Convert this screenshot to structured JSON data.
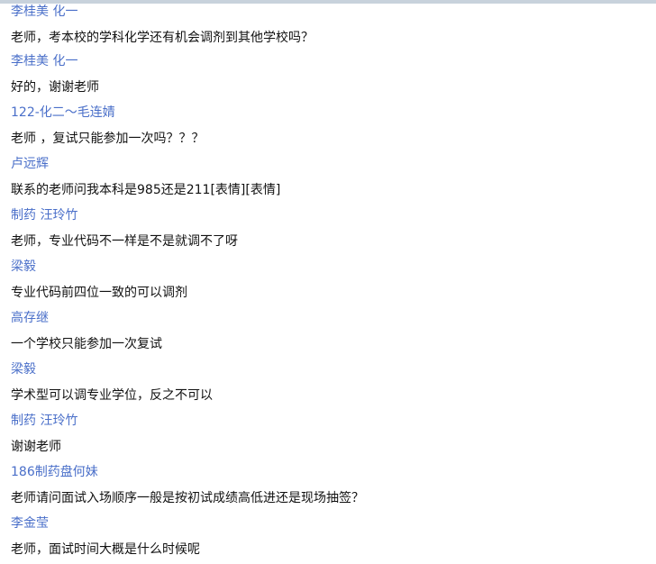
{
  "colors": {
    "sender": "#4a6fc9",
    "text": "#111111",
    "top_border": "#c8d2dc",
    "background": "#ffffff"
  },
  "messages": [
    {
      "sender": "李桂美  化一",
      "text": "老师，考本校的学科化学还有机会调剂到其他学校吗？"
    },
    {
      "sender": "李桂美  化一",
      "text": "好的，谢谢老师"
    },
    {
      "sender": "122-化二～毛连婧",
      "text": "老师 ，复试只能参加一次吗？？？"
    },
    {
      "sender": "卢远辉",
      "text": "联系的老师问我本科是985还是211[表情][表情]"
    },
    {
      "sender": "制药 汪玲竹",
      "text": "老师，专业代码不一样是不是就调不了呀"
    },
    {
      "sender": "梁毅",
      "text": "专业代码前四位一致的可以调剂"
    },
    {
      "sender": "高存继",
      "text": "一个学校只能参加一次复试"
    },
    {
      "sender": "梁毅",
      "text": "学术型可以调专业学位，反之不可以"
    },
    {
      "sender": "制药 汪玲竹",
      "text": "谢谢老师"
    },
    {
      "sender": "186制药盘何妹",
      "text": "老师请问面试入场顺序一般是按初试成绩高低进还是现场抽签？"
    },
    {
      "sender": "李金莹",
      "text": "老师，面试时间大概是什么时候呢"
    }
  ]
}
